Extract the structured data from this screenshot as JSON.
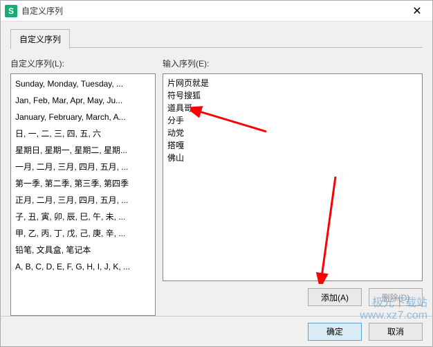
{
  "window": {
    "app_icon_letter": "S",
    "title": "自定义序列"
  },
  "tab": {
    "label": "自定义序列"
  },
  "left": {
    "label": "自定义序列(L):",
    "items": [
      "Sunday, Monday, Tuesday, ...",
      "Jan, Feb, Mar, Apr, May, Ju...",
      "January, February, March, A...",
      "日, 一, 二, 三, 四, 五, 六",
      "星期日, 星期一, 星期二, 星期...",
      "一月, 二月, 三月, 四月, 五月, ...",
      "第一季, 第二季, 第三季, 第四季",
      "正月, 二月, 三月, 四月, 五月, ...",
      "子, 丑, 寅, 卯, 辰, 巳, 午, 未, ...",
      "甲, 乙, 丙, 丁, 戊, 己, 庚, 辛, ...",
      "铅笔, 文具盒, 笔记本",
      "A, B, C, D, E, F, G, H, I, J, K, ..."
    ]
  },
  "right": {
    "label": "输入序列(E):",
    "text": "片网页就是\n符号搜狐\n道具哥\n分手\n动党\n搭嘎\n佛山"
  },
  "buttons": {
    "add": "添加(A)",
    "delete": "删除(D)",
    "ok": "确定",
    "cancel": "取消"
  },
  "watermark": {
    "line1": "极光下载站",
    "line2": "www.xz7.com"
  }
}
